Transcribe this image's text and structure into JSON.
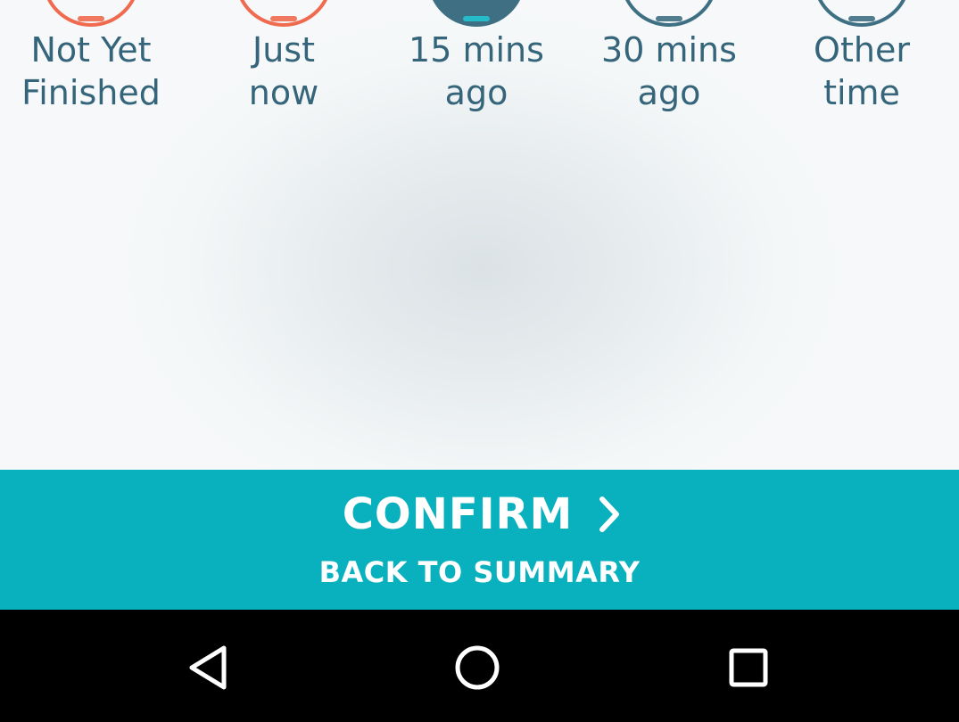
{
  "time_options": [
    {
      "label": "Not Yet\nFinished",
      "color": "#f06a4f",
      "selected": false
    },
    {
      "label": "Just\nnow",
      "color": "#f06a4f",
      "selected": false
    },
    {
      "label": "15 mins\nago",
      "color": "#3f6f82",
      "selected": true
    },
    {
      "label": "30 mins\nago",
      "color": "#3f6f82",
      "selected": false
    },
    {
      "label": "Other\ntime",
      "color": "#3f6f82",
      "selected": false
    }
  ],
  "actions": {
    "confirm_label": "CONFIRM",
    "back_label": "BACK TO SUMMARY",
    "accent_color": "#08b1bd"
  },
  "navigation": {
    "back_icon": "triangle-back-icon",
    "home_icon": "circle-home-icon",
    "recents_icon": "square-recents-icon"
  }
}
